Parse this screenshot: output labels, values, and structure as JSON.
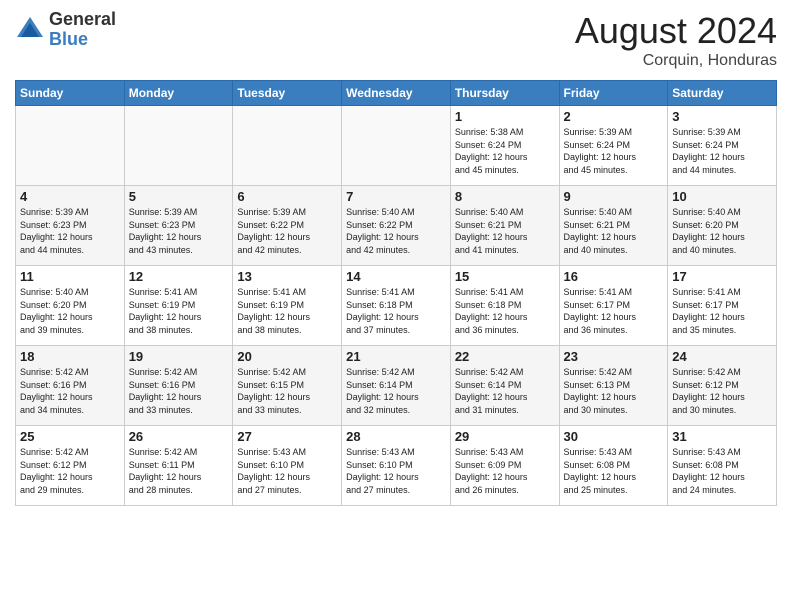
{
  "logo": {
    "general": "General",
    "blue": "Blue"
  },
  "title": {
    "month": "August 2024",
    "location": "Corquin, Honduras"
  },
  "days_of_week": [
    "Sunday",
    "Monday",
    "Tuesday",
    "Wednesday",
    "Thursday",
    "Friday",
    "Saturday"
  ],
  "weeks": [
    [
      {
        "day": "",
        "info": ""
      },
      {
        "day": "",
        "info": ""
      },
      {
        "day": "",
        "info": ""
      },
      {
        "day": "",
        "info": ""
      },
      {
        "day": "1",
        "info": "Sunrise: 5:38 AM\nSunset: 6:24 PM\nDaylight: 12 hours\nand 45 minutes."
      },
      {
        "day": "2",
        "info": "Sunrise: 5:39 AM\nSunset: 6:24 PM\nDaylight: 12 hours\nand 45 minutes."
      },
      {
        "day": "3",
        "info": "Sunrise: 5:39 AM\nSunset: 6:24 PM\nDaylight: 12 hours\nand 44 minutes."
      }
    ],
    [
      {
        "day": "4",
        "info": "Sunrise: 5:39 AM\nSunset: 6:23 PM\nDaylight: 12 hours\nand 44 minutes."
      },
      {
        "day": "5",
        "info": "Sunrise: 5:39 AM\nSunset: 6:23 PM\nDaylight: 12 hours\nand 43 minutes."
      },
      {
        "day": "6",
        "info": "Sunrise: 5:39 AM\nSunset: 6:22 PM\nDaylight: 12 hours\nand 42 minutes."
      },
      {
        "day": "7",
        "info": "Sunrise: 5:40 AM\nSunset: 6:22 PM\nDaylight: 12 hours\nand 42 minutes."
      },
      {
        "day": "8",
        "info": "Sunrise: 5:40 AM\nSunset: 6:21 PM\nDaylight: 12 hours\nand 41 minutes."
      },
      {
        "day": "9",
        "info": "Sunrise: 5:40 AM\nSunset: 6:21 PM\nDaylight: 12 hours\nand 40 minutes."
      },
      {
        "day": "10",
        "info": "Sunrise: 5:40 AM\nSunset: 6:20 PM\nDaylight: 12 hours\nand 40 minutes."
      }
    ],
    [
      {
        "day": "11",
        "info": "Sunrise: 5:40 AM\nSunset: 6:20 PM\nDaylight: 12 hours\nand 39 minutes."
      },
      {
        "day": "12",
        "info": "Sunrise: 5:41 AM\nSunset: 6:19 PM\nDaylight: 12 hours\nand 38 minutes."
      },
      {
        "day": "13",
        "info": "Sunrise: 5:41 AM\nSunset: 6:19 PM\nDaylight: 12 hours\nand 38 minutes."
      },
      {
        "day": "14",
        "info": "Sunrise: 5:41 AM\nSunset: 6:18 PM\nDaylight: 12 hours\nand 37 minutes."
      },
      {
        "day": "15",
        "info": "Sunrise: 5:41 AM\nSunset: 6:18 PM\nDaylight: 12 hours\nand 36 minutes."
      },
      {
        "day": "16",
        "info": "Sunrise: 5:41 AM\nSunset: 6:17 PM\nDaylight: 12 hours\nand 36 minutes."
      },
      {
        "day": "17",
        "info": "Sunrise: 5:41 AM\nSunset: 6:17 PM\nDaylight: 12 hours\nand 35 minutes."
      }
    ],
    [
      {
        "day": "18",
        "info": "Sunrise: 5:42 AM\nSunset: 6:16 PM\nDaylight: 12 hours\nand 34 minutes."
      },
      {
        "day": "19",
        "info": "Sunrise: 5:42 AM\nSunset: 6:16 PM\nDaylight: 12 hours\nand 33 minutes."
      },
      {
        "day": "20",
        "info": "Sunrise: 5:42 AM\nSunset: 6:15 PM\nDaylight: 12 hours\nand 33 minutes."
      },
      {
        "day": "21",
        "info": "Sunrise: 5:42 AM\nSunset: 6:14 PM\nDaylight: 12 hours\nand 32 minutes."
      },
      {
        "day": "22",
        "info": "Sunrise: 5:42 AM\nSunset: 6:14 PM\nDaylight: 12 hours\nand 31 minutes."
      },
      {
        "day": "23",
        "info": "Sunrise: 5:42 AM\nSunset: 6:13 PM\nDaylight: 12 hours\nand 30 minutes."
      },
      {
        "day": "24",
        "info": "Sunrise: 5:42 AM\nSunset: 6:12 PM\nDaylight: 12 hours\nand 30 minutes."
      }
    ],
    [
      {
        "day": "25",
        "info": "Sunrise: 5:42 AM\nSunset: 6:12 PM\nDaylight: 12 hours\nand 29 minutes."
      },
      {
        "day": "26",
        "info": "Sunrise: 5:42 AM\nSunset: 6:11 PM\nDaylight: 12 hours\nand 28 minutes."
      },
      {
        "day": "27",
        "info": "Sunrise: 5:43 AM\nSunset: 6:10 PM\nDaylight: 12 hours\nand 27 minutes."
      },
      {
        "day": "28",
        "info": "Sunrise: 5:43 AM\nSunset: 6:10 PM\nDaylight: 12 hours\nand 27 minutes."
      },
      {
        "day": "29",
        "info": "Sunrise: 5:43 AM\nSunset: 6:09 PM\nDaylight: 12 hours\nand 26 minutes."
      },
      {
        "day": "30",
        "info": "Sunrise: 5:43 AM\nSunset: 6:08 PM\nDaylight: 12 hours\nand 25 minutes."
      },
      {
        "day": "31",
        "info": "Sunrise: 5:43 AM\nSunset: 6:08 PM\nDaylight: 12 hours\nand 24 minutes."
      }
    ]
  ]
}
